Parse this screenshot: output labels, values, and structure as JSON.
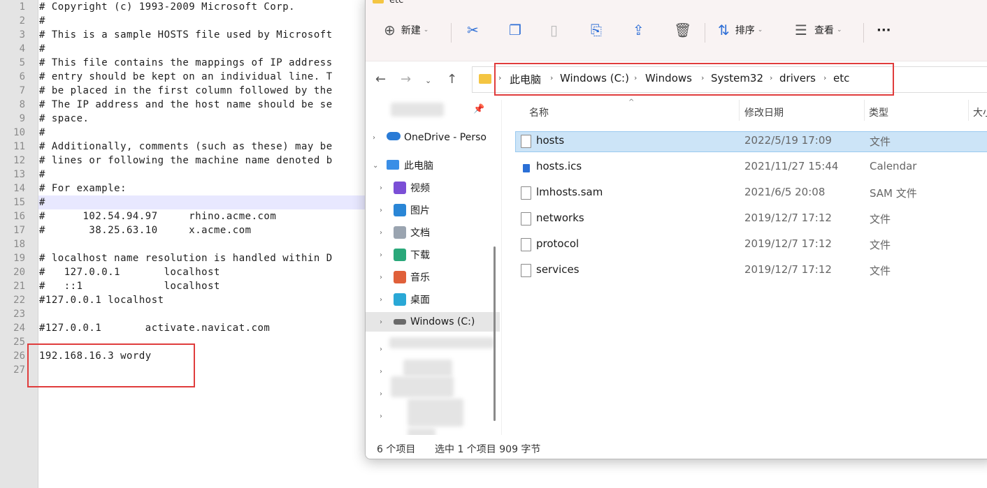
{
  "editor": {
    "lines": [
      {
        "n": "1",
        "text": "# Copyright (c) 1993-2009 Microsoft Corp."
      },
      {
        "n": "2",
        "text": "#"
      },
      {
        "n": "3",
        "text": "# This is a sample HOSTS file used by Microsoft"
      },
      {
        "n": "4",
        "text": "#"
      },
      {
        "n": "5",
        "text": "# This file contains the mappings of IP address"
      },
      {
        "n": "6",
        "text": "# entry should be kept on an individual line. T"
      },
      {
        "n": "7",
        "text": "# be placed in the first column followed by the"
      },
      {
        "n": "8",
        "text": "# The IP address and the host name should be se"
      },
      {
        "n": "9",
        "text": "# space."
      },
      {
        "n": "10",
        "text": "#"
      },
      {
        "n": "11",
        "text": "# Additionally, comments (such as these) may be"
      },
      {
        "n": "12",
        "text": "# lines or following the machine name denoted b"
      },
      {
        "n": "13",
        "text": "#"
      },
      {
        "n": "14",
        "text": "# For example:"
      },
      {
        "n": "15",
        "text": "#"
      },
      {
        "n": "16",
        "text": "#      102.54.94.97     rhino.acme.com"
      },
      {
        "n": "17",
        "text": "#       38.25.63.10     x.acme.com"
      },
      {
        "n": "18",
        "text": ""
      },
      {
        "n": "19",
        "text": "# localhost name resolution is handled within D"
      },
      {
        "n": "20",
        "text": "#   127.0.0.1       localhost"
      },
      {
        "n": "21",
        "text": "#   ::1             localhost"
      },
      {
        "n": "22",
        "text": "#127.0.0.1 localhost"
      },
      {
        "n": "23",
        "text": ""
      },
      {
        "n": "24",
        "text": "#127.0.0.1       activate.navicat.com"
      },
      {
        "n": "25",
        "text": ""
      },
      {
        "n": "26",
        "text": "192.168.16.3 wordy"
      },
      {
        "n": "27",
        "text": ""
      }
    ]
  },
  "explorer": {
    "title": "etc",
    "toolbar": {
      "new_label": "新建",
      "sort_label": "排序",
      "view_label": "查看",
      "more_label": "···"
    },
    "breadcrumb": [
      "此电脑",
      "Windows (C:)",
      "Windows",
      "System32",
      "drivers",
      "etc"
    ],
    "sidebar": {
      "onedrive": "OneDrive - Perso",
      "this_pc": "此电脑",
      "items": [
        "视频",
        "图片",
        "文档",
        "下载",
        "音乐",
        "桌面",
        "Windows (C:)"
      ]
    },
    "columns": {
      "name": "名称",
      "date": "修改日期",
      "type": "类型",
      "size": "大小"
    },
    "files": [
      {
        "name": "hosts",
        "date": "2022/5/19 17:09",
        "type": "文件"
      },
      {
        "name": "hosts.ics",
        "date": "2021/11/27 15:44",
        "type": "Calendar"
      },
      {
        "name": "lmhosts.sam",
        "date": "2021/6/5 20:08",
        "type": "SAM 文件"
      },
      {
        "name": "networks",
        "date": "2019/12/7 17:12",
        "type": "文件"
      },
      {
        "name": "protocol",
        "date": "2019/12/7 17:12",
        "type": "文件"
      },
      {
        "name": "services",
        "date": "2019/12/7 17:12",
        "type": "文件"
      }
    ],
    "status": {
      "count": "6 个项目",
      "selected": "选中 1 个项目  909 字节"
    },
    "colors": {
      "accent": "#2f6fd6",
      "highlight_box": "#e03c3c",
      "selected_row": "#cce4f7"
    }
  }
}
